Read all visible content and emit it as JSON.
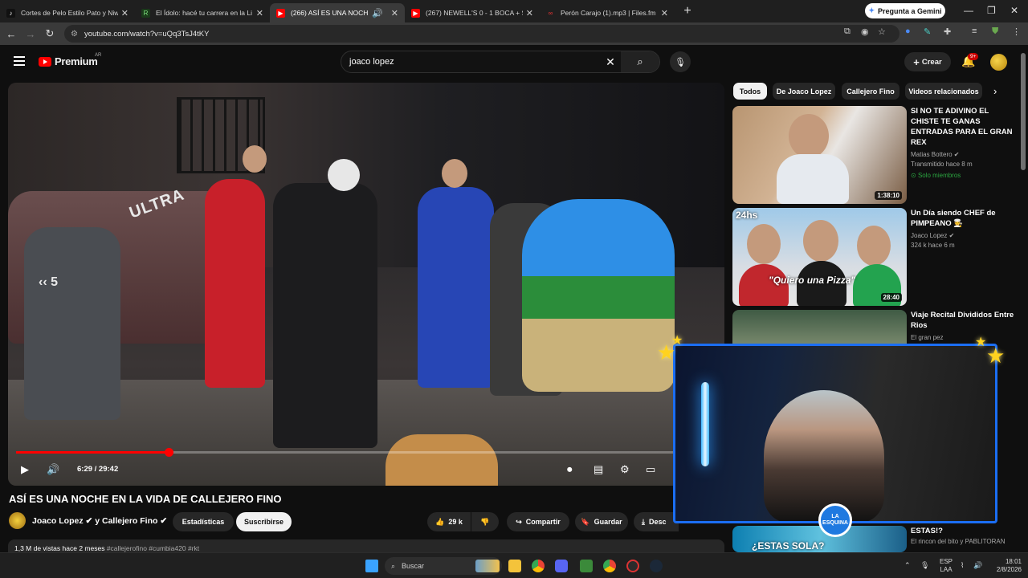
{
  "browser": {
    "tabs": [
      {
        "title": "Cortes de Pelo Estilo Pato y Niw",
        "fav_color": "#111111",
        "fav_glyph": "♪",
        "active": false
      },
      {
        "title": "El Ídolo: hacé tu carrera en la Li",
        "fav_color": "#1a3b1a",
        "fav_glyph": "R",
        "active": false
      },
      {
        "title": "(266) ASÍ ES UNA NOCHE E",
        "fav_color": "#ff0000",
        "fav_glyph": "▶",
        "active": true
      },
      {
        "title": "(267) NEWELL'S 0 - 1 BOCA + S",
        "fav_color": "#ff0000",
        "fav_glyph": "▶",
        "active": false
      },
      {
        "title": "Perón Carajo (1).mp3 | Files.fm",
        "fav_color": "#d33",
        "fav_glyph": "∞",
        "active": false
      }
    ],
    "new_tab": "+",
    "gemini_button": "Pregunta a Gemini",
    "url": "youtube.com/watch?v=uQq3TsJ4tKY"
  },
  "youtube": {
    "logo_text": "Premium",
    "country_code": "AR",
    "search_query": "joaco lopez",
    "create_label": "Crear",
    "notifications_badge": "9+"
  },
  "player": {
    "time": "6:29 / 29:42",
    "progress_fraction": 0.218,
    "skip_label": "5",
    "overlay_brand": "ULTRA"
  },
  "video": {
    "title": "ASÍ ES UNA NOCHE EN LA VIDA DE CALLEJERO FINO",
    "channel": "Joaco Lopez ✔ y Callejero Fino ✔",
    "stats_button": "Estadísticas",
    "subscribe_button": "Suscribirse",
    "likes": "29 k",
    "share_label": "Compartir",
    "save_label": "Guardar",
    "download_label": "Desc",
    "desc_line": "1,3 M de vistas  hace 2 meses",
    "desc_tags": "#callejerofino #cumbia420 #rkt"
  },
  "sidebar": {
    "chips": [
      "Todos",
      "De Joaco Lopez",
      "Callejero Fino",
      "Videos relacionados"
    ],
    "recommendations": [
      {
        "title": "SI NO TE ADIVINO EL CHISTE TE GANAS ENTRADAS PARA EL GRAN REX",
        "channel": "Matias Bottero ✔",
        "meta": "Transmitido hace 8 m",
        "badge": "Solo miembros",
        "duration": "1:38:10",
        "thumb_text": ""
      },
      {
        "title": "Un Día siendo CHEF de PIMPEANO 🧑‍🍳",
        "channel": "Joaco Lopez ✔",
        "meta": "324 k  hace 6 m",
        "badge": "",
        "duration": "28:40",
        "thumb_text": "\"Quiero una Pizza\""
      },
      {
        "title": "Viaje Recital Divididos Entre Rios",
        "channel": "El gran pez",
        "meta": "",
        "badge": "",
        "duration": "",
        "thumb_text": ""
      },
      {
        "title": "ESTAS!?",
        "channel": "El rincon del bito y PABLITORAN",
        "meta": "",
        "badge": "",
        "duration": "",
        "thumb_text": "¿ESTAS SOLA?"
      }
    ],
    "thumb_label_24hs": "24hs"
  },
  "overlay": {
    "cam_logo_text": "LA ESQUINA"
  },
  "taskbar": {
    "search_placeholder": "Buscar",
    "lang_top": "ESP",
    "lang_bottom": "LAA",
    "time": "18:01",
    "date": "2/8/2026"
  }
}
